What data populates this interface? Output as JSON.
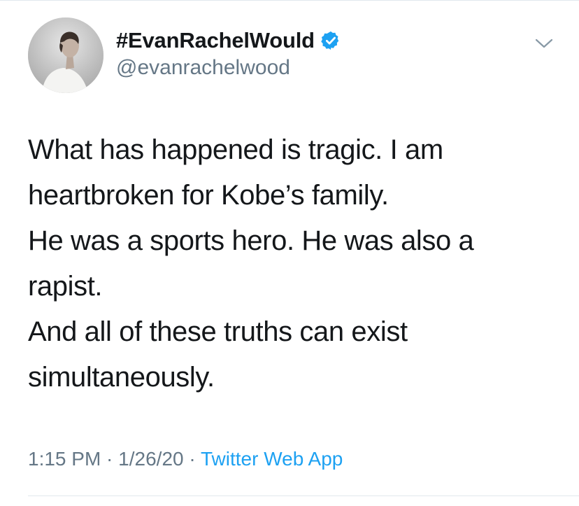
{
  "author": {
    "display_name": "#EvanRachelWould",
    "handle": "@evanrachelwood",
    "verified_icon": "verified-badge-icon",
    "avatar_icon": "profile-photo"
  },
  "menu": {
    "icon": "chevron-down-icon"
  },
  "tweet": {
    "lines": [
      "What has happened is tragic. I am",
      "heartbroken for Kobe’s family.",
      "He was a sports hero. He was also a",
      "rapist.",
      "And all of these truths can exist",
      "simultaneously."
    ]
  },
  "meta": {
    "time": "1:15 PM",
    "separator": " · ",
    "date": "1/26/20",
    "source": "Twitter Web App"
  },
  "colors": {
    "text": "#14171a",
    "secondary": "#657786",
    "accent": "#1da1f2",
    "divider": "#e1e8ed"
  }
}
